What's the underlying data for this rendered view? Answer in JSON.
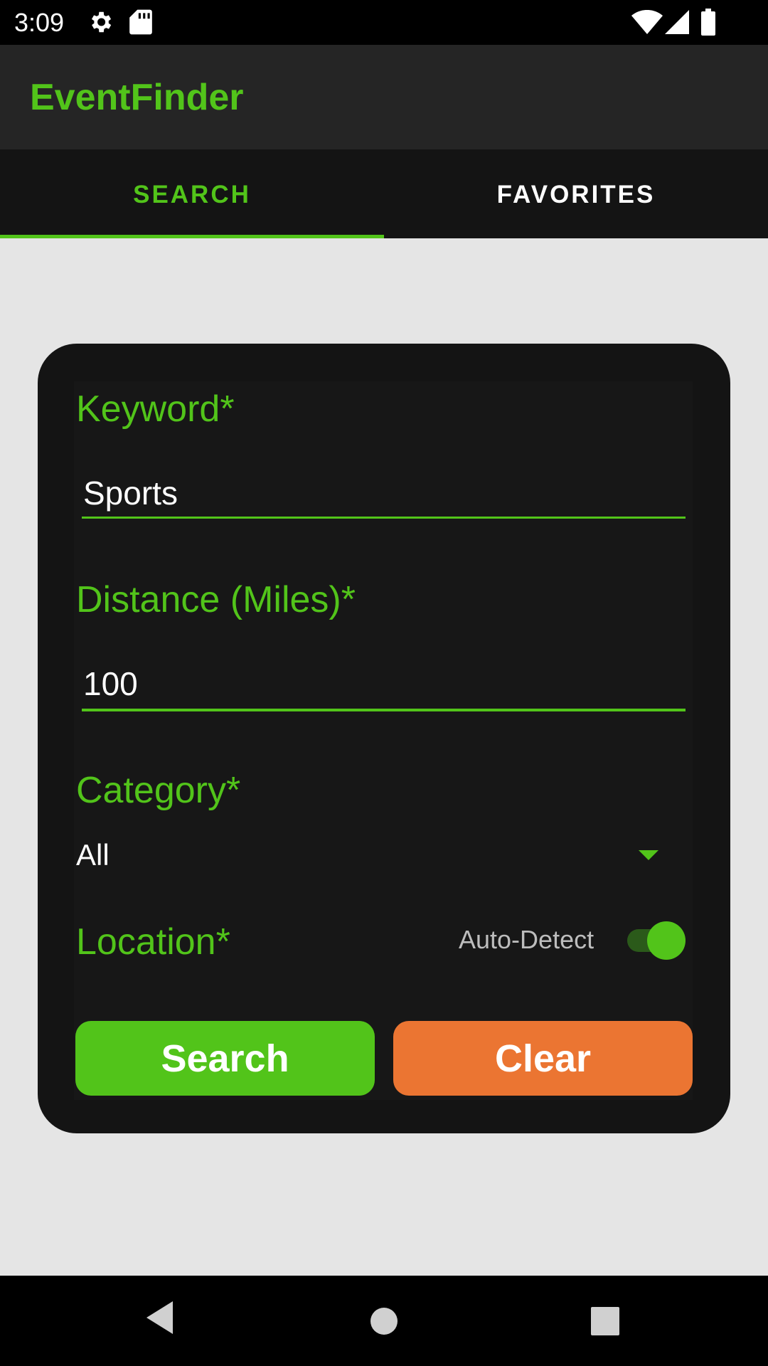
{
  "status_bar": {
    "time": "3:09",
    "icons": [
      "gear-icon",
      "sd-card-icon",
      "wifi-icon",
      "signal-icon",
      "battery-icon"
    ]
  },
  "app_bar": {
    "title": "EventFinder"
  },
  "tabs": [
    {
      "label": "SEARCH",
      "selected": true
    },
    {
      "label": "FAVORITES",
      "selected": false
    }
  ],
  "form": {
    "keyword": {
      "label": "Keyword*",
      "value": "Sports"
    },
    "distance": {
      "label": "Distance (Miles)*",
      "value": "100"
    },
    "category": {
      "label": "Category*",
      "value": "All"
    },
    "location": {
      "label": "Location*",
      "auto_detect_label": "Auto-Detect",
      "auto_detect_on": true
    },
    "search_button": "Search",
    "clear_button": "Clear"
  },
  "nav_bar": {
    "icons": [
      "back-icon",
      "home-icon",
      "recents-icon"
    ]
  },
  "colors": {
    "accent": "#52c41a",
    "clear": "#eb7532",
    "card": "#141414",
    "background": "#e5e5e5"
  }
}
